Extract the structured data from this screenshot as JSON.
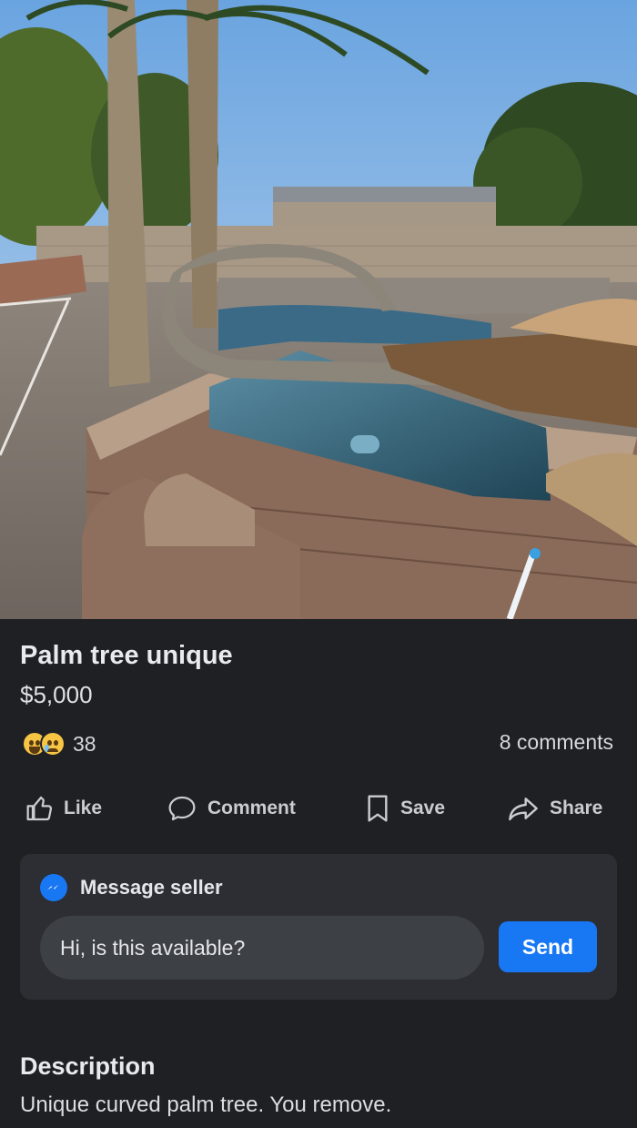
{
  "listing": {
    "title": "Palm tree unique",
    "price": "$5,000",
    "photo": {
      "icon": "listing-photo",
      "description_visible": false
    }
  },
  "engagement": {
    "reaction_icons": [
      "laughing-emoji-icon",
      "crying-emoji-icon"
    ],
    "reaction_count": "38",
    "comments": "8 comments"
  },
  "actions": {
    "like": "Like",
    "comment": "Comment",
    "save": "Save",
    "share": "Share"
  },
  "message": {
    "header": "Message seller",
    "input_value": "Hi, is this available?",
    "send": "Send",
    "accent": "#1877f2"
  },
  "description": {
    "heading": "Description",
    "text": "Unique curved palm tree. You remove."
  }
}
